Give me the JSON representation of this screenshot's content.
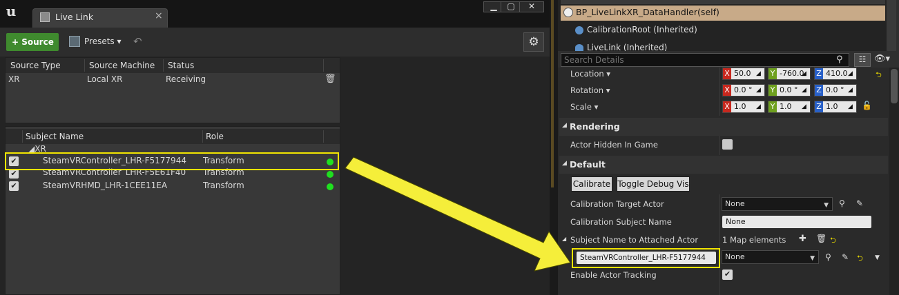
{
  "window": {
    "tab_title": "Live Link",
    "tab_close": "×",
    "min_glyph": "▁",
    "max_glyph": "▢",
    "close_glyph": "✕",
    "logo_glyph": "u"
  },
  "toolbar": {
    "source_label": "+ Source ▾",
    "presets_label": "Presets ▾",
    "undo_glyph": "↶",
    "settings_glyph": "⚙"
  },
  "sources": {
    "headers": [
      "Source Type",
      "Source Machine",
      "Status"
    ],
    "rows": [
      {
        "type": "XR",
        "machine": "Local XR",
        "status": "Receiving"
      }
    ],
    "trash_glyph": "🗑"
  },
  "subjects": {
    "headers": [
      "Subject Name",
      "Role"
    ],
    "group": "◢XR",
    "rows": [
      {
        "name": "SteamVRController_LHR-F5177944",
        "role": "Transform",
        "checked": true
      },
      {
        "name": "SteamVRController_LHR-F5E61F40",
        "role": "Transform",
        "checked": true
      },
      {
        "name": "SteamVRHMD_LHR-1CEE11EA",
        "role": "Transform",
        "checked": true
      }
    ],
    "check_glyph": "✔",
    "status_color": "#1fe01f"
  },
  "components": {
    "self": "BP_LiveLinkXR_DataHandler(self)",
    "items": [
      "CalibrationRoot (Inherited)",
      "LiveLink (Inherited)"
    ]
  },
  "details": {
    "search_placeholder": "Search Details",
    "search_glyph": "⚲",
    "grid_glyph": "☷",
    "eye_glyph": "👁▾",
    "transform": [
      {
        "label": "Location ▾",
        "x": "50.0",
        "y": "-760.0",
        "z": "410.0"
      },
      {
        "label": "Rotation ▾",
        "x": "0.0 °",
        "y": "0.0 °",
        "z": "0.0 °"
      },
      {
        "label": "Scale ▾",
        "x": "1.0",
        "y": "1.0",
        "z": "1.0"
      }
    ],
    "axis_labels": [
      "X",
      "Y",
      "Z"
    ],
    "rendering": {
      "title": "Rendering",
      "actor_hidden_label": "Actor Hidden In Game"
    },
    "default": {
      "title": "Default",
      "calibrate_label": "Calibrate",
      "toggle_debug_label": "Toggle Debug Vis",
      "cal_target_actor_label": "Calibration Target Actor",
      "cal_target_actor_value": "None",
      "cal_subject_name_label": "Calibration Subject Name",
      "cal_subject_name_value": "None",
      "subject_map_label": "Subject Name to Attached Actor",
      "subject_map_count": "1 Map elements",
      "map_key": "SteamVRController_LHR-F5177944",
      "map_value": "None",
      "enable_tracking_label": "Enable Actor Tracking",
      "enable_tracking_checked": true
    },
    "expand_glyph": "◢",
    "plus_glyph": "✚",
    "reset_glyph": "⮌",
    "pick_glyph": "⚲",
    "dropper_glyph": "✎",
    "lock_glyph": "🔓",
    "spin_glyph": "◢",
    "combo_glyph": "▼",
    "check_glyph": "✔"
  },
  "colors": {
    "highlight": "#f2e500",
    "arrow": "#f5ee3a",
    "source_button": "#3f8a2e",
    "self_row": "#c8aa88"
  }
}
